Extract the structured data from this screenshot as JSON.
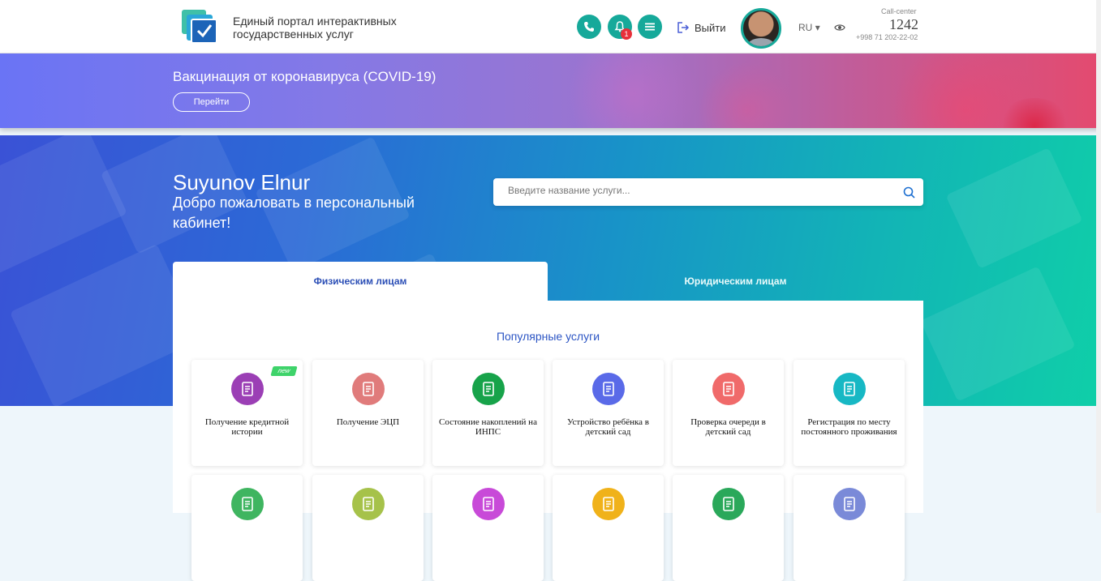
{
  "header": {
    "brand_line1": "Единый портал интерактивных",
    "brand_line2": "государственных услуг",
    "notification_count": "1",
    "logout_label": "Выйти",
    "language": "RU",
    "call_center_label": "Call-center",
    "call_center_number": "1242",
    "call_center_phone": "+998 71 202-22-02",
    "icons": [
      "phone-icon",
      "bell-icon",
      "menu-icon",
      "logout-icon",
      "eye-icon"
    ]
  },
  "banner": {
    "title": "Вакцинация от коронавируса (COVID-19)",
    "button_label": "Перейти"
  },
  "hero": {
    "user_name": "Suyunov Elnur",
    "welcome_text": "Добро пожаловать в персональный кабинет!",
    "search_placeholder": "Введите название услуги..."
  },
  "tabs": [
    {
      "label": "Физическим лицам",
      "active": true
    },
    {
      "label": "Юридическим лицам",
      "active": false
    }
  ],
  "services": {
    "title": "Популярные услуги",
    "cards": [
      {
        "label": "Получение кредитной истории",
        "color": "#9b3fb5",
        "icon": "credit-report-icon",
        "badge": "new"
      },
      {
        "label": "Получение ЭЦП",
        "color": "#e07b7b",
        "icon": "signature-icon"
      },
      {
        "label": "Состояние накоплений на ИНПС",
        "color": "#17a34a",
        "icon": "coins-icon"
      },
      {
        "label": "Устройство ребёнка в детский сад",
        "color": "#5a6ae8",
        "icon": "kindergarten-icon"
      },
      {
        "label": "Проверка очереди в детский сад",
        "color": "#f06a6a",
        "icon": "queue-icon"
      },
      {
        "label": "Регистрация по месту постоянного проживания",
        "color": "#17b8c4",
        "icon": "residence-icon"
      },
      {
        "label": "",
        "color": "#3fb560",
        "icon": "property-icon"
      },
      {
        "label": "",
        "color": "#a6c24a",
        "icon": "document-icon"
      },
      {
        "label": "",
        "color": "#c84ad8",
        "icon": "wallet-icon"
      },
      {
        "label": "",
        "color": "#f0b21a",
        "icon": "form-icon"
      },
      {
        "label": "",
        "color": "#2aa85a",
        "icon": "certificate-icon"
      },
      {
        "label": "",
        "color": "#7a8ad8",
        "icon": "house-doc-icon"
      }
    ]
  }
}
